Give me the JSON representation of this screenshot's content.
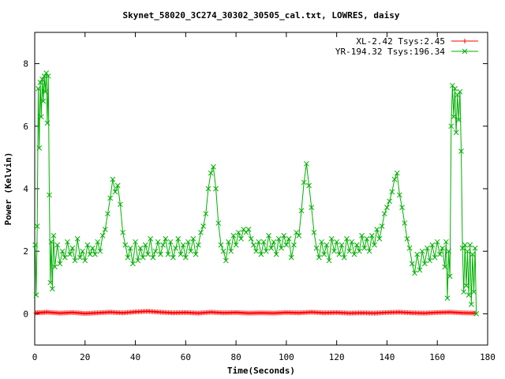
{
  "chart_data": {
    "type": "line",
    "title": "Skynet_58020_3C274_30302_30505_cal.txt, LOWRES, daisy",
    "xlabel": "Time(Seconds)",
    "ylabel": "Power (Kelvin)",
    "xlim": [
      0,
      180
    ],
    "ylim": [
      -1,
      9
    ],
    "xticks": [
      0,
      20,
      40,
      60,
      80,
      100,
      120,
      140,
      160,
      180
    ],
    "yticks": [
      0,
      2,
      4,
      6,
      8
    ],
    "grid": false,
    "legend_position": "top-right",
    "series": [
      {
        "name": "XL-2.42 Tsys:2.45",
        "color": "#ff0000",
        "marker": "plus",
        "points": [
          [
            0.5,
            0.03
          ],
          [
            5,
            0.05
          ],
          [
            10,
            0.02
          ],
          [
            15,
            0.04
          ],
          [
            20,
            0.01
          ],
          [
            25,
            0.03
          ],
          [
            30,
            0.05
          ],
          [
            35,
            0.03
          ],
          [
            40,
            0.06
          ],
          [
            45,
            0.08
          ],
          [
            50,
            0.05
          ],
          [
            55,
            0.03
          ],
          [
            60,
            0.04
          ],
          [
            65,
            0.02
          ],
          [
            70,
            0.05
          ],
          [
            75,
            0.03
          ],
          [
            80,
            0.04
          ],
          [
            85,
            0.02
          ],
          [
            90,
            0.03
          ],
          [
            95,
            0.02
          ],
          [
            100,
            0.04
          ],
          [
            105,
            0.03
          ],
          [
            110,
            0.05
          ],
          [
            115,
            0.03
          ],
          [
            120,
            0.04
          ],
          [
            125,
            0.02
          ],
          [
            130,
            0.03
          ],
          [
            135,
            0.02
          ],
          [
            140,
            0.04
          ],
          [
            145,
            0.05
          ],
          [
            150,
            0.03
          ],
          [
            155,
            0.02
          ],
          [
            160,
            0.04
          ],
          [
            165,
            0.05
          ],
          [
            170,
            0.03
          ],
          [
            175,
            0.02
          ]
        ]
      },
      {
        "name": "YR-194.32 Tsys:196.34",
        "color": "#00b000",
        "marker": "x",
        "points": [
          [
            0.2,
            2.2
          ],
          [
            0.6,
            0.6
          ],
          [
            1.0,
            2.8
          ],
          [
            1.4,
            7.2
          ],
          [
            1.8,
            5.3
          ],
          [
            2.2,
            7.4
          ],
          [
            2.6,
            6.3
          ],
          [
            3.0,
            7.5
          ],
          [
            3.4,
            6.8
          ],
          [
            3.8,
            7.6
          ],
          [
            4.2,
            7.1
          ],
          [
            4.6,
            7.7
          ],
          [
            5.0,
            6.1
          ],
          [
            5.4,
            7.6
          ],
          [
            5.8,
            3.8
          ],
          [
            6.2,
            1.0
          ],
          [
            6.6,
            2.3
          ],
          [
            7.0,
            0.8
          ],
          [
            7.5,
            2.5
          ],
          [
            8.0,
            1.5
          ],
          [
            9,
            2.2
          ],
          [
            10,
            1.6
          ],
          [
            11,
            2.0
          ],
          [
            12,
            1.8
          ],
          [
            13,
            2.3
          ],
          [
            14,
            1.9
          ],
          [
            15,
            2.1
          ],
          [
            16,
            1.7
          ],
          [
            17,
            2.4
          ],
          [
            18,
            1.8
          ],
          [
            19,
            2.0
          ],
          [
            20,
            1.7
          ],
          [
            21,
            2.2
          ],
          [
            22,
            1.9
          ],
          [
            23,
            2.1
          ],
          [
            24,
            1.9
          ],
          [
            25,
            2.3
          ],
          [
            26,
            2.0
          ],
          [
            27,
            2.5
          ],
          [
            28,
            2.7
          ],
          [
            29,
            3.2
          ],
          [
            30,
            3.7
          ],
          [
            31,
            4.3
          ],
          [
            32,
            3.9
          ],
          [
            33,
            4.1
          ],
          [
            34,
            3.5
          ],
          [
            35,
            2.6
          ],
          [
            36,
            2.2
          ],
          [
            37,
            1.8
          ],
          [
            38,
            2.1
          ],
          [
            39,
            1.6
          ],
          [
            40,
            2.3
          ],
          [
            41,
            1.7
          ],
          [
            42,
            2.1
          ],
          [
            43,
            1.8
          ],
          [
            44,
            2.2
          ],
          [
            45,
            1.9
          ],
          [
            46,
            2.4
          ],
          [
            47,
            1.8
          ],
          [
            48,
            2.0
          ],
          [
            49,
            2.3
          ],
          [
            50,
            1.9
          ],
          [
            51,
            2.2
          ],
          [
            52,
            2.4
          ],
          [
            53,
            1.9
          ],
          [
            54,
            2.3
          ],
          [
            55,
            1.8
          ],
          [
            56,
            2.1
          ],
          [
            57,
            2.4
          ],
          [
            58,
            1.9
          ],
          [
            59,
            2.2
          ],
          [
            60,
            1.8
          ],
          [
            61,
            2.3
          ],
          [
            62,
            2.0
          ],
          [
            63,
            2.4
          ],
          [
            64,
            1.9
          ],
          [
            65,
            2.2
          ],
          [
            66,
            2.6
          ],
          [
            67,
            2.8
          ],
          [
            68,
            3.2
          ],
          [
            69,
            4.0
          ],
          [
            70,
            4.5
          ],
          [
            71,
            4.7
          ],
          [
            72,
            4.0
          ],
          [
            73,
            2.9
          ],
          [
            74,
            2.2
          ],
          [
            75,
            2.0
          ],
          [
            76,
            1.7
          ],
          [
            77,
            2.3
          ],
          [
            78,
            2.0
          ],
          [
            79,
            2.5
          ],
          [
            80,
            2.2
          ],
          [
            81,
            2.6
          ],
          [
            82,
            2.4
          ],
          [
            83,
            2.7
          ],
          [
            84,
            2.6
          ],
          [
            85,
            2.7
          ],
          [
            86,
            2.4
          ],
          [
            87,
            2.2
          ],
          [
            88,
            2.0
          ],
          [
            89,
            2.3
          ],
          [
            90,
            1.9
          ],
          [
            91,
            2.3
          ],
          [
            92,
            2.0
          ],
          [
            93,
            2.5
          ],
          [
            94,
            2.1
          ],
          [
            95,
            2.3
          ],
          [
            96,
            1.9
          ],
          [
            97,
            2.4
          ],
          [
            98,
            2.1
          ],
          [
            99,
            2.5
          ],
          [
            100,
            2.2
          ],
          [
            101,
            2.4
          ],
          [
            102,
            1.8
          ],
          [
            103,
            2.2
          ],
          [
            104,
            2.6
          ],
          [
            105,
            2.5
          ],
          [
            106,
            3.3
          ],
          [
            107,
            4.2
          ],
          [
            108,
            4.8
          ],
          [
            109,
            4.1
          ],
          [
            110,
            3.4
          ],
          [
            111,
            2.6
          ],
          [
            112,
            2.1
          ],
          [
            113,
            1.8
          ],
          [
            114,
            2.3
          ],
          [
            115,
            1.9
          ],
          [
            116,
            2.2
          ],
          [
            117,
            1.7
          ],
          [
            118,
            2.4
          ],
          [
            119,
            2.0
          ],
          [
            120,
            2.3
          ],
          [
            121,
            1.9
          ],
          [
            122,
            2.2
          ],
          [
            123,
            1.8
          ],
          [
            124,
            2.4
          ],
          [
            125,
            2.0
          ],
          [
            126,
            2.3
          ],
          [
            127,
            1.9
          ],
          [
            128,
            2.2
          ],
          [
            129,
            2.0
          ],
          [
            130,
            2.5
          ],
          [
            131,
            2.1
          ],
          [
            132,
            2.4
          ],
          [
            133,
            2.0
          ],
          [
            134,
            2.5
          ],
          [
            135,
            2.2
          ],
          [
            136,
            2.7
          ],
          [
            137,
            2.4
          ],
          [
            138,
            2.8
          ],
          [
            139,
            3.2
          ],
          [
            140,
            3.4
          ],
          [
            141,
            3.6
          ],
          [
            142,
            3.9
          ],
          [
            143,
            4.3
          ],
          [
            144,
            4.5
          ],
          [
            145,
            3.8
          ],
          [
            146,
            3.4
          ],
          [
            147,
            2.9
          ],
          [
            148,
            2.4
          ],
          [
            149,
            2.1
          ],
          [
            150,
            1.6
          ],
          [
            151,
            1.3
          ],
          [
            152,
            1.9
          ],
          [
            153,
            1.4
          ],
          [
            154,
            2.0
          ],
          [
            155,
            1.6
          ],
          [
            156,
            2.1
          ],
          [
            157,
            1.7
          ],
          [
            158,
            2.2
          ],
          [
            159,
            1.8
          ],
          [
            160,
            2.3
          ],
          [
            161,
            1.9
          ],
          [
            162,
            2.1
          ],
          [
            163,
            1.5
          ],
          [
            163.5,
            2.3
          ],
          [
            164,
            0.5
          ],
          [
            164.5,
            2.0
          ],
          [
            165,
            1.2
          ],
          [
            165.5,
            6.0
          ],
          [
            166,
            7.3
          ],
          [
            166.5,
            6.3
          ],
          [
            167,
            7.2
          ],
          [
            167.5,
            5.8
          ],
          [
            168,
            7.0
          ],
          [
            168.5,
            6.2
          ],
          [
            169,
            7.1
          ],
          [
            169.5,
            5.2
          ],
          [
            170,
            2.1
          ],
          [
            170.5,
            0.7
          ],
          [
            171,
            2.2
          ],
          [
            171.5,
            0.9
          ],
          [
            172,
            2.0
          ],
          [
            172.5,
            0.6
          ],
          [
            173,
            2.2
          ],
          [
            173.5,
            0.3
          ],
          [
            174,
            1.9
          ],
          [
            174.5,
            0.7
          ],
          [
            175,
            2.1
          ],
          [
            175.5,
            0.0
          ]
        ]
      }
    ]
  }
}
